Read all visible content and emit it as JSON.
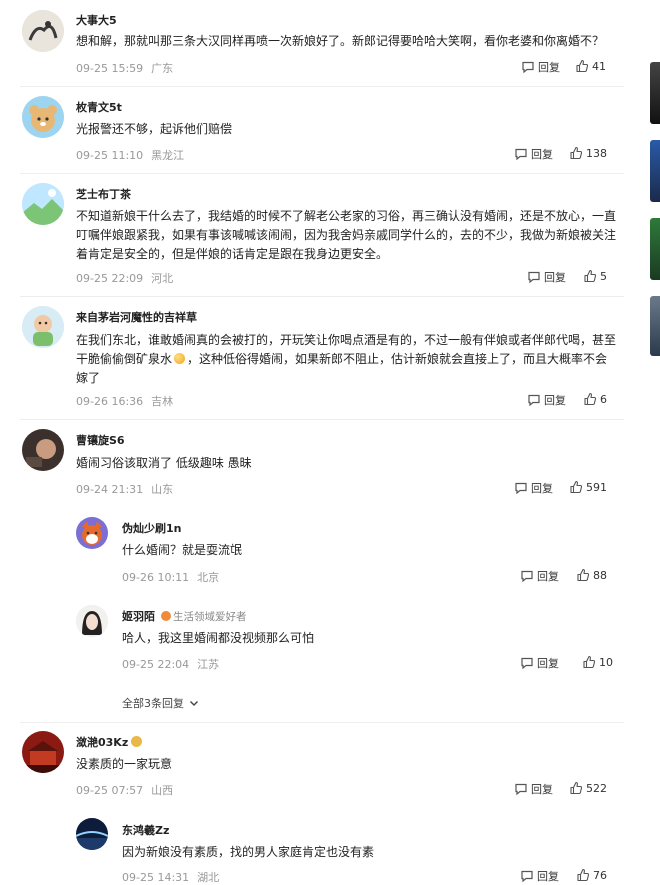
{
  "comments": [
    {
      "user": "大事大5",
      "text": "想和解，那就叫那三条大汉同样再喷一次新娘好了。新郎记得要哈哈大笑啊，看你老婆和你离婚不？",
      "time": "09-25 15:59",
      "location": "广东",
      "reply_label": "回复",
      "likes": "41"
    },
    {
      "user": "枚青文5t",
      "text": "光报警还不够，起诉他们赔偿",
      "time": "09-25 11:10",
      "location": "黑龙江",
      "reply_label": "回复",
      "likes": "138"
    },
    {
      "user": "芝士布丁茶",
      "text": "不知道新娘干什么去了，我结婚的时候不了解老公老家的习俗，再三确认没有婚闹，还是不放心，一直叮嘱伴娘跟紧我，如果有事该喊喊该闹闹，因为我舍妈亲戚同学什么的，去的不少，我做为新娘被关注着肯定是安全的，但是伴娘的话肯定是跟在我身边更安全。",
      "time": "09-25 22:09",
      "location": "河北",
      "reply_label": "回复",
      "likes": "5"
    },
    {
      "user": "来自茅岩河魔性的吉祥草",
      "text_a": "在我们东北，谁敢婚闹真的会被打的，开玩笑让你喝点酒是有的，不过一般有伴娘或者伴郎代喝，甚至干脆偷偷倒矿泉水",
      "text_b": "，这种低俗得婚闹，如果新郎不阻止，估计新娘就会直接上了，而且大概率不会嫁了",
      "time": "09-26 16:36",
      "location": "吉林",
      "reply_label": "回复",
      "likes": "6"
    },
    {
      "user": "曹镶旋S6",
      "text": "婚闹习俗该取消了 低级趣味 愚昧",
      "time": "09-24 21:31",
      "location": "山东",
      "reply_label": "回复",
      "likes": "591"
    }
  ],
  "replies": [
    {
      "user": "伪灿少刷1n",
      "text": "什么婚闹？就是耍流氓",
      "time": "09-26 10:11",
      "location": "北京",
      "reply_label": "回复",
      "likes": "88"
    },
    {
      "user": "姬羽陌",
      "tag": "生活领域爱好者",
      "text": "哈人，我这里婚闹都没视频那么可怕",
      "time": "09-25 22:04",
      "location": "江苏",
      "reply_label": "回复",
      "likes": "10"
    }
  ],
  "expand_label": "全部3条回复",
  "comment6": {
    "user": "潋滟03Kz",
    "text": "没素质的一家玩意",
    "time": "09-25 07:57",
    "location": "山西",
    "reply_label": "回复",
    "likes": "522"
  },
  "reply3": {
    "user": "东鸿羲Zz",
    "text": "因为新娘没有素质，找的男人家庭肯定也没有素",
    "time": "09-25 14:31",
    "location": "湖北",
    "reply_label": "回复",
    "likes": "76"
  },
  "colors": {
    "meta": "#999999",
    "text": "#222222",
    "divider": "#eeeeee"
  }
}
